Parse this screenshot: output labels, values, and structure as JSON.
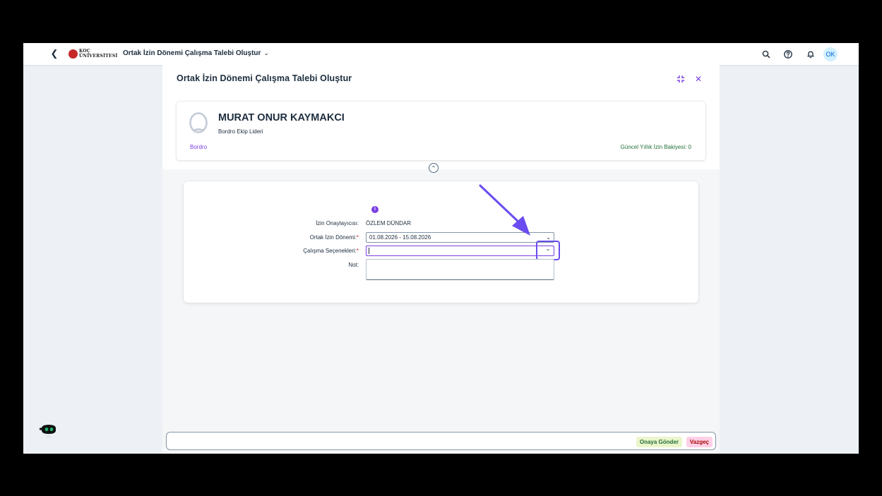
{
  "shell": {
    "logo_top": "KOÇ",
    "logo_bottom": "ÜNİVERSİTESİ",
    "app_title": "Ortak İzin Dönemi Çalışma Talebi Oluştur",
    "avatar_initials": "OK"
  },
  "page": {
    "title": "Ortak İzin Dönemi Çalışma Talebi Oluştur"
  },
  "employee": {
    "name": "MURAT ONUR KAYMAKCI",
    "role": "Bordro Ekip Lideri",
    "department": "Bordro",
    "balance": "Güncel Yıllık İzin Bakiyesi: 0"
  },
  "form": {
    "approver_label": "İzin Onaylayıcısı:",
    "approver_value": "ÖZLEM DÜNDAR",
    "period_label": "Ortak İzin Dönemi:",
    "period_value": "01.08.2026 - 15.08.2026",
    "options_label": "Çalışma Seçenekleri:",
    "options_value": "",
    "note_label": "Not:",
    "required_mark": "*"
  },
  "footer": {
    "submit_label": "Onaya Gönder",
    "cancel_label": "Vazgeç"
  },
  "colors": {
    "accent": "#7b3fe4",
    "annotation": "#6a4cf0",
    "positive": "#256f3a",
    "negative": "#aa0808"
  }
}
